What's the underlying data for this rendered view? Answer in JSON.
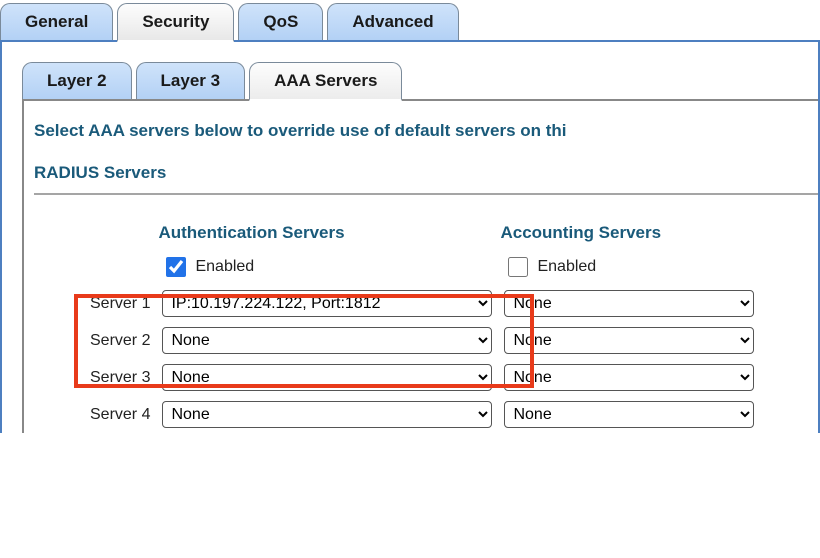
{
  "tabs_primary": [
    {
      "label": "General",
      "active": false
    },
    {
      "label": "Security",
      "active": true
    },
    {
      "label": "QoS",
      "active": false
    },
    {
      "label": "Advanced",
      "active": false
    }
  ],
  "tabs_secondary": [
    {
      "label": "Layer 2",
      "active": false
    },
    {
      "label": "Layer 3",
      "active": false
    },
    {
      "label": "AAA Servers",
      "active": true
    }
  ],
  "instruction": "Select AAA servers below to override use of default servers on thi",
  "radius": {
    "title": "RADIUS Servers",
    "auth_header": "Authentication Servers",
    "acct_header": "Accounting Servers",
    "enabled_label": "Enabled",
    "auth_enabled": true,
    "acct_enabled": false,
    "rows": [
      {
        "label": "Server 1",
        "auth": "IP:10.197.224.122, Port:1812",
        "acct": "None"
      },
      {
        "label": "Server 2",
        "auth": "None",
        "acct": "None"
      },
      {
        "label": "Server 3",
        "auth": "None",
        "acct": "None"
      },
      {
        "label": "Server 4",
        "auth": "None",
        "acct": "None"
      }
    ]
  }
}
